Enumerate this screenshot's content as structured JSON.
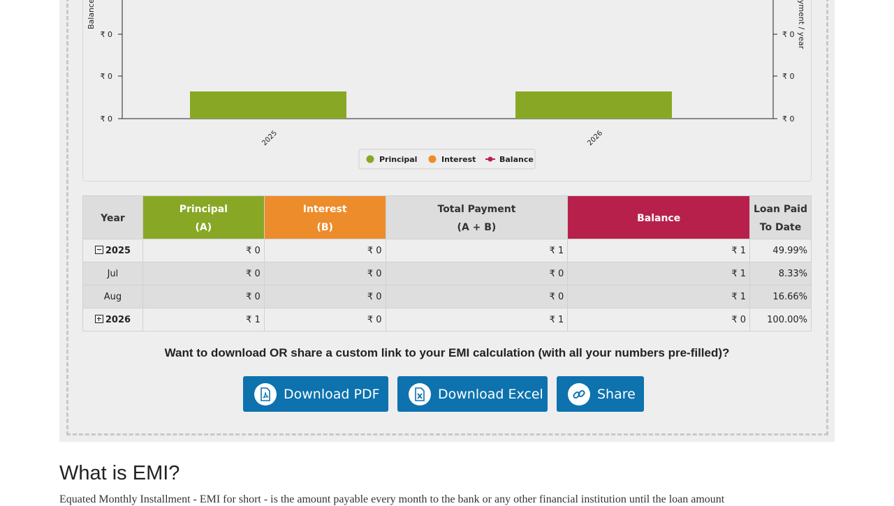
{
  "chart_data": {
    "type": "bar",
    "categories": [
      "2025",
      "2026"
    ],
    "series": [
      {
        "name": "Principal",
        "values": [
          0,
          1
        ],
        "color": "#88a825"
      },
      {
        "name": "Interest",
        "values": [
          0,
          0
        ],
        "color": "#ed8c2b"
      },
      {
        "name": "Balance",
        "values": [
          1,
          0
        ],
        "color": "#b8204c"
      }
    ],
    "ylabel_left": "Balance",
    "ylabel_right": "ayment / year",
    "left_ticks": [
      "₹ 0",
      "₹ 0",
      "₹ 0"
    ],
    "right_ticks": [
      "₹ 0",
      "₹ 0",
      "₹ 0"
    ],
    "legend_position": "bottom"
  },
  "table": {
    "headers": {
      "year": "Year",
      "principal": "Principal",
      "principal_sub": "(A)",
      "interest": "Interest",
      "interest_sub": "(B)",
      "total": "Total Payment",
      "total_sub": "(A + B)",
      "balance": "Balance",
      "paid": "Loan Paid",
      "paid_sub": "To Date"
    },
    "rows": [
      {
        "year": "2025",
        "principal": "₹ 0",
        "interest": "₹ 0",
        "total": "₹ 1",
        "balance": "₹ 1",
        "paid": "49.99%"
      },
      {
        "year": "Jul",
        "principal": "₹ 0",
        "interest": "₹ 0",
        "total": "₹ 0",
        "balance": "₹ 1",
        "paid": "8.33%"
      },
      {
        "year": "Aug",
        "principal": "₹ 0",
        "interest": "₹ 0",
        "total": "₹ 0",
        "balance": "₹ 1",
        "paid": "16.66%"
      },
      {
        "year": "2026",
        "principal": "₹ 1",
        "interest": "₹ 0",
        "total": "₹ 1",
        "balance": "₹ 0",
        "paid": "100.00%"
      }
    ]
  },
  "prompt_text": "Want to download OR share a custom link to your EMI calculation (with all your numbers pre-filled)?",
  "buttons": {
    "pdf": "Download PDF",
    "excel": "Download Excel",
    "share": "Share"
  },
  "section_heading": "What is EMI?",
  "section_text": "Equated Monthly Installment - EMI for short - is the amount payable every month to the bank or any other financial institution until the loan amount"
}
